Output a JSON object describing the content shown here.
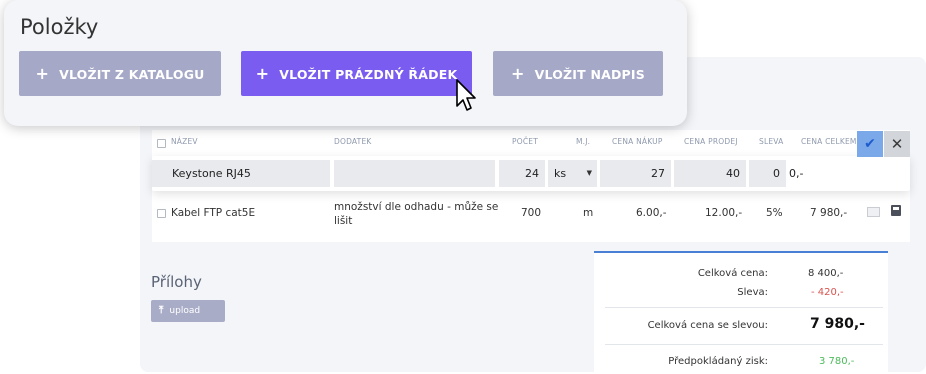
{
  "popup": {
    "title": "Položky",
    "buttons": [
      {
        "label": "VLOŽIT Z KATALOGU",
        "plus": "+"
      },
      {
        "label": "VLOŽIT PRÁZDNÝ ŘÁDEK",
        "plus": "+"
      },
      {
        "label": "VLOŽIT NADPIS",
        "plus": "+"
      }
    ]
  },
  "table": {
    "columns": [
      "NÁZEV",
      "DODATEK",
      "POČET",
      "M.J.",
      "CENA NÁKUP",
      "CENA PRODEJ",
      "SLEVA",
      "CENA CELKEM"
    ],
    "edit_row": {
      "name": "Keystone RJ45",
      "addition": "",
      "count": "24",
      "unit": "ks",
      "buy_price": "27",
      "sell_price": "40",
      "discount": "0",
      "total": "0,-"
    },
    "rows": [
      {
        "name": "Kabel FTP cat5E",
        "addition_line1": "množství dle odhadu - může se",
        "addition_line2": "lišit",
        "count": "700",
        "unit": "m",
        "buy_price": "6.00,-",
        "sell_price": "12.00,-",
        "discount": "5%",
        "total": "7 980,-"
      }
    ]
  },
  "attachments": {
    "title": "Přílohy",
    "upload_label": "upload"
  },
  "totals": {
    "total_label": "Celková cena:",
    "total_value": "8 400,-",
    "discount_label": "Sleva:",
    "discount_value": "- 420,-",
    "discounted_label": "Celková cena se slevou:",
    "discounted_value": "7 980,-",
    "profit_label": "Předpokládaný zisk:",
    "profit_value": "3 780,-"
  },
  "colors": {
    "accent": "#7b5cf0",
    "button_gray": "#a5a8c6",
    "discount_red": "#d9534f",
    "profit_green": "#4cbb5a"
  }
}
